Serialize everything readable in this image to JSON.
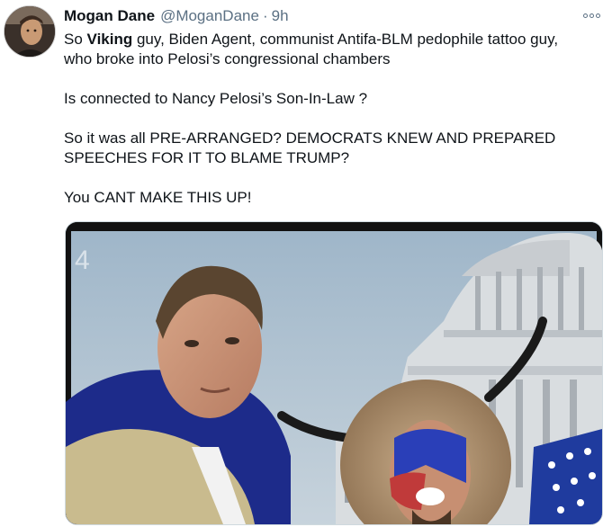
{
  "tweet": {
    "author_name": "Mogan Dane",
    "author_handle": "@MoganDane",
    "separator": "·",
    "time": "9h",
    "more_icon": "more-horizontal-icon",
    "lines": {
      "l1_pre": "So ",
      "l1_bold": "Viking",
      "l1_post": " guy, Biden Agent, communist Antifa-BLM pedophile tattoo guy,",
      "l2": "who broke into Pelosi’s congressional chambers",
      "l3": "Is connected to Nancy Pelosi’s Son-In-Law ?",
      "l4": "So it was all PRE-ARRANGED? DEMOCRATS KNEW AND PREPARED",
      "l5": "SPEECHES FOR IT TO BLAME TRUMP?",
      "l6": "You CANT MAKE THIS UP!"
    },
    "media": {
      "channel_mark": "4"
    }
  },
  "colors": {
    "text": "#0f1419",
    "secondary": "#5b7083",
    "border": "#cfd9de"
  }
}
